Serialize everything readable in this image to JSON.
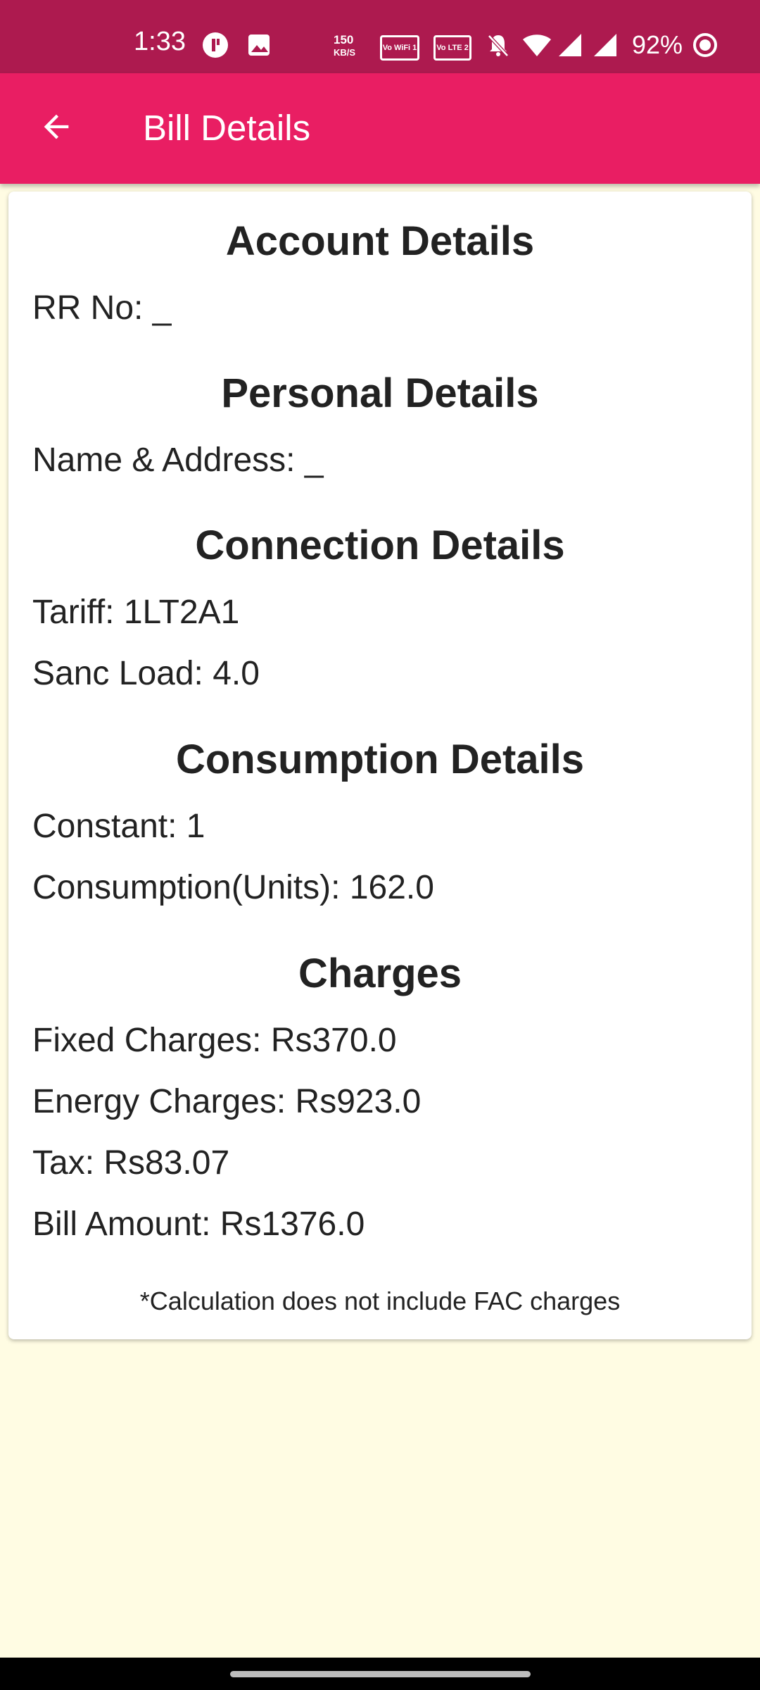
{
  "status_bar": {
    "time": "1:33",
    "net_speed_value": "150",
    "net_speed_unit": "KB/S",
    "sim1_label": "Vo WiFi 1",
    "sim2_label": "Vo LTE 2",
    "battery": "92%",
    "background_color": "#AD1A4F"
  },
  "app_bar": {
    "title": "Bill Details",
    "back_icon": "arrow-back-icon",
    "color": "#E91E63"
  },
  "sections": {
    "account": {
      "heading": "Account Details",
      "rr_no": "RR No: _"
    },
    "personal": {
      "heading": "Personal Details",
      "name_address": "Name & Address: _"
    },
    "connection": {
      "heading": "Connection Details",
      "tariff": "Tariff: 1LT2A1",
      "sanc_load": "Sanc Load: 4.0"
    },
    "consumption": {
      "heading": "Consumption Details",
      "constant": "Constant: 1",
      "units": "Consumption(Units): 162.0"
    },
    "charges": {
      "heading": "Charges",
      "fixed": "Fixed Charges: Rs370.0",
      "energy": "Energy Charges: Rs923.0",
      "tax": "Tax: Rs83.07",
      "bill_amount": "Bill Amount: Rs1376.0"
    }
  },
  "note": "*Calculation does not include FAC charges",
  "background_color": "#FFFCE3"
}
